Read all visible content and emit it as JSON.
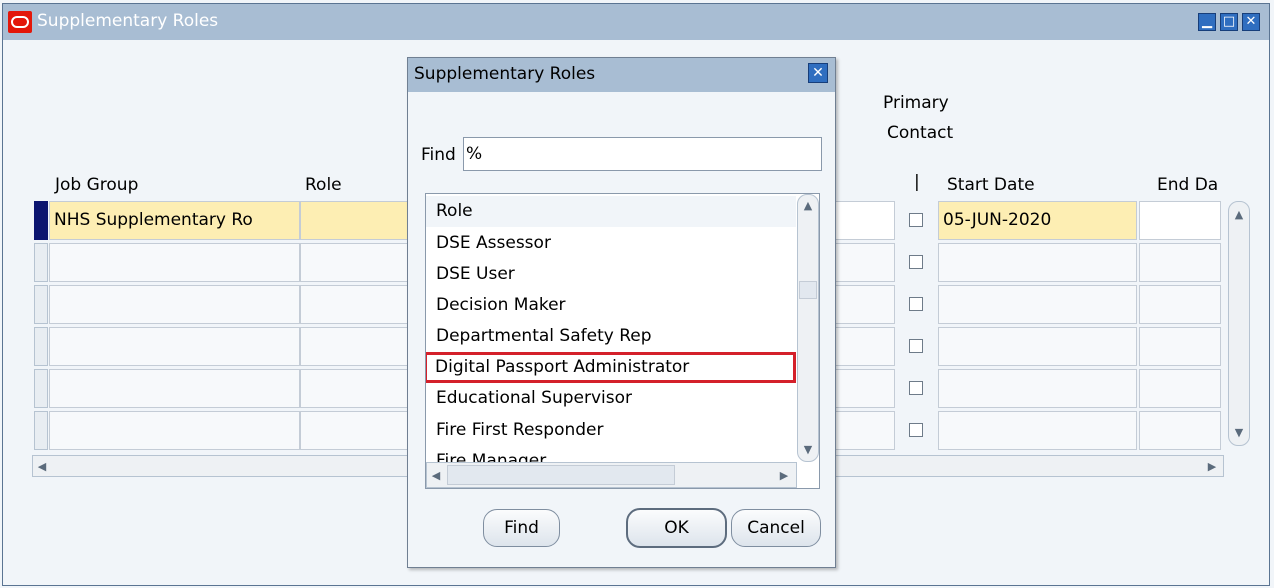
{
  "window": {
    "title": "Supplementary Roles",
    "controls": {
      "minimize": "▁",
      "maximize": "□",
      "close": "✕"
    }
  },
  "columns": {
    "primary_contact_line1": "Primary",
    "primary_contact_line2": "Contact",
    "job_group": "Job Group",
    "role": "Role",
    "indicator": "|",
    "start_date": "Start Date",
    "end_date": "End Da"
  },
  "rows": [
    {
      "job_group": "NHS Supplementary Ro",
      "role": "",
      "start_date": "05-JUN-2020",
      "end_date": ""
    },
    {
      "job_group": "",
      "role": "",
      "start_date": "",
      "end_date": ""
    },
    {
      "job_group": "",
      "role": "",
      "start_date": "",
      "end_date": ""
    },
    {
      "job_group": "",
      "role": "",
      "start_date": "",
      "end_date": ""
    },
    {
      "job_group": "",
      "role": "",
      "start_date": "",
      "end_date": ""
    },
    {
      "job_group": "",
      "role": "",
      "start_date": "",
      "end_date": ""
    }
  ],
  "dialog": {
    "title": "Supplementary Roles",
    "close": "✕",
    "find_label": "Find",
    "find_value": "%",
    "list_header": "Role",
    "items": [
      "DSE Assessor",
      "DSE User",
      "Decision Maker",
      "Departmental Safety Rep",
      "Digital Passport Administrator",
      "Educational Supervisor",
      "Fire First Responder",
      "Fire Manager"
    ],
    "selected_item": "Digital Passport Administrator",
    "buttons": {
      "find": "Find",
      "ok": "OK",
      "cancel": "Cancel"
    }
  },
  "colors": {
    "titlebar": "#a8bdd3",
    "active_cell": "#fdeeb3",
    "highlight_border": "#d4202a",
    "current_row_indicator": "#0b1470"
  },
  "icons": [
    "oracle-logo-icon",
    "minimize-icon",
    "maximize-icon",
    "close-icon",
    "scroll-up-arrow-icon",
    "scroll-down-arrow-icon",
    "scroll-left-arrow-icon",
    "scroll-right-arrow-icon"
  ]
}
